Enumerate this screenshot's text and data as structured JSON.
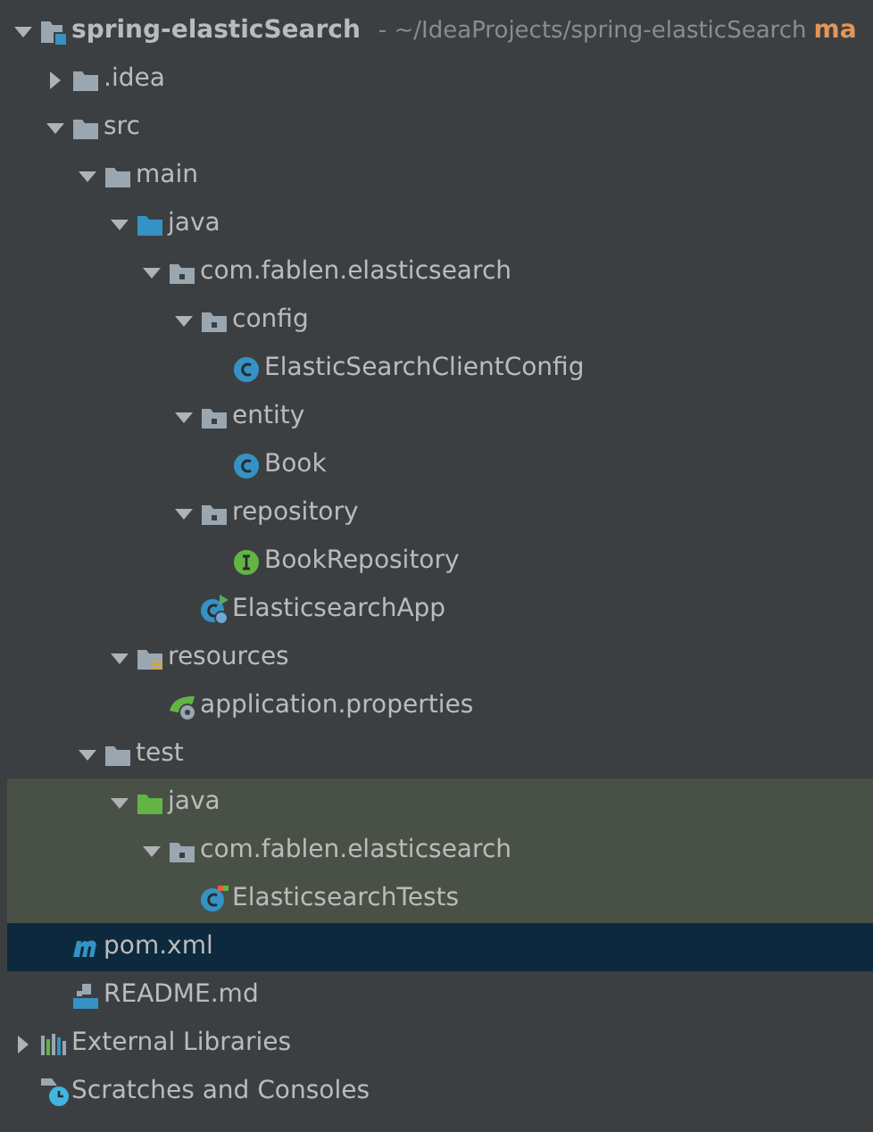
{
  "project_tree": {
    "items": [
      {
        "kind": "project",
        "label": "spring-elasticSearch",
        "path": "- ~/IdeaProjects/spring-elasticSearch",
        "branch": "ma",
        "expanded": true,
        "selected": false,
        "test_scope": false,
        "children": [
          {
            "kind": "folder",
            "label": ".idea",
            "expanded": false,
            "selected": false,
            "test_scope": false
          },
          {
            "kind": "folder",
            "label": "src",
            "expanded": true,
            "selected": false,
            "test_scope": false,
            "children": [
              {
                "kind": "folder",
                "label": "main",
                "expanded": true,
                "selected": false,
                "test_scope": false,
                "children": [
                  {
                    "kind": "source-folder",
                    "label": "java",
                    "expanded": true,
                    "selected": false,
                    "test_scope": false,
                    "children": [
                      {
                        "kind": "package",
                        "label": "com.fablen.elasticsearch",
                        "expanded": true,
                        "selected": false,
                        "test_scope": false,
                        "children": [
                          {
                            "kind": "package",
                            "label": "config",
                            "expanded": true,
                            "selected": false,
                            "test_scope": false,
                            "children": [
                              {
                                "kind": "class",
                                "label": "ElasticSearchClientConfig",
                                "selected": false,
                                "test_scope": false
                              }
                            ]
                          },
                          {
                            "kind": "package",
                            "label": "entity",
                            "expanded": true,
                            "selected": false,
                            "test_scope": false,
                            "children": [
                              {
                                "kind": "class",
                                "label": "Book",
                                "selected": false,
                                "test_scope": false
                              }
                            ]
                          },
                          {
                            "kind": "package",
                            "label": "repository",
                            "expanded": true,
                            "selected": false,
                            "test_scope": false,
                            "children": [
                              {
                                "kind": "interface",
                                "label": "BookRepository",
                                "selected": false,
                                "test_scope": false
                              }
                            ]
                          },
                          {
                            "kind": "spring-app",
                            "label": "ElasticsearchApp",
                            "selected": false,
                            "test_scope": false
                          }
                        ]
                      }
                    ]
                  },
                  {
                    "kind": "resources",
                    "label": "resources",
                    "expanded": true,
                    "selected": false,
                    "test_scope": false,
                    "children": [
                      {
                        "kind": "spring-props",
                        "label": "application.properties",
                        "selected": false,
                        "test_scope": false
                      }
                    ]
                  }
                ]
              },
              {
                "kind": "folder",
                "label": "test",
                "expanded": true,
                "selected": false,
                "test_scope": false,
                "children": [
                  {
                    "kind": "test-folder",
                    "label": "java",
                    "expanded": true,
                    "selected": false,
                    "test_scope": true,
                    "children": [
                      {
                        "kind": "package",
                        "label": "com.fablen.elasticsearch",
                        "expanded": true,
                        "selected": false,
                        "test_scope": true,
                        "children": [
                          {
                            "kind": "test-class",
                            "label": "ElasticsearchTests",
                            "selected": false,
                            "test_scope": true
                          }
                        ]
                      }
                    ]
                  }
                ]
              }
            ]
          },
          {
            "kind": "maven",
            "label": "pom.xml",
            "selected": true,
            "test_scope": false
          },
          {
            "kind": "markdown",
            "label": "README.md",
            "selected": false,
            "test_scope": false
          }
        ]
      },
      {
        "kind": "libraries",
        "label": "External Libraries",
        "expanded": false,
        "selected": false,
        "test_scope": false
      },
      {
        "kind": "scratches",
        "label": "Scratches and Consoles",
        "selected": false,
        "test_scope": false
      }
    ]
  }
}
